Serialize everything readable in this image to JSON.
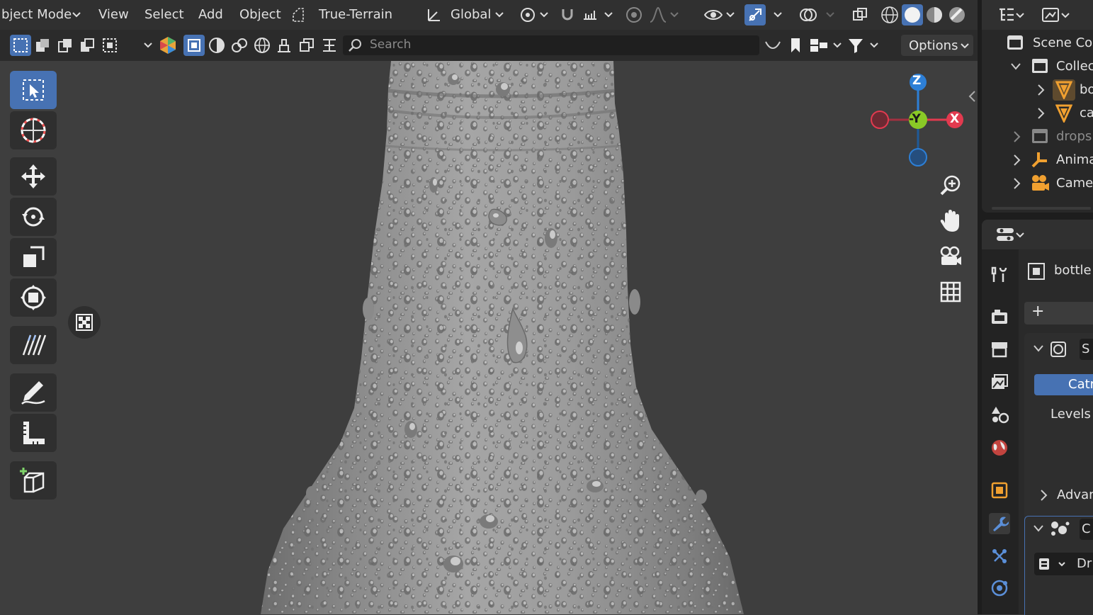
{
  "header": {
    "mode": "bject Mode",
    "menus": [
      "View",
      "Select",
      "Add",
      "Object"
    ],
    "snap_preset": "True-Terrain",
    "orientation": "Global"
  },
  "toolbar2": {
    "search_placeholder": "Search",
    "options_label": "Options"
  },
  "gizmo": {
    "z_label": "Z",
    "y_label": "-Y",
    "x_label": "X",
    "colors": {
      "x": "#e23a4f",
      "y": "#8ac926",
      "z": "#2d7fd6"
    }
  },
  "outliner": {
    "scene_label": "Scene Col",
    "items": [
      {
        "label": "Collec"
      },
      {
        "label": "bo"
      },
      {
        "label": "ca"
      },
      {
        "label": "drops"
      },
      {
        "label": "Anima"
      },
      {
        "label": "Camer"
      }
    ]
  },
  "properties": {
    "object_name": "bottle",
    "add_label": "+",
    "modifier_letter": "S",
    "button_label": "Catr",
    "levels_label": "Levels V",
    "advanced_label": "Advan",
    "geo_letter": "C",
    "dr_label": "Dr"
  },
  "colors": {
    "accent": "#4772b3",
    "header": "#303030",
    "viewport": "#3e3e3e"
  }
}
